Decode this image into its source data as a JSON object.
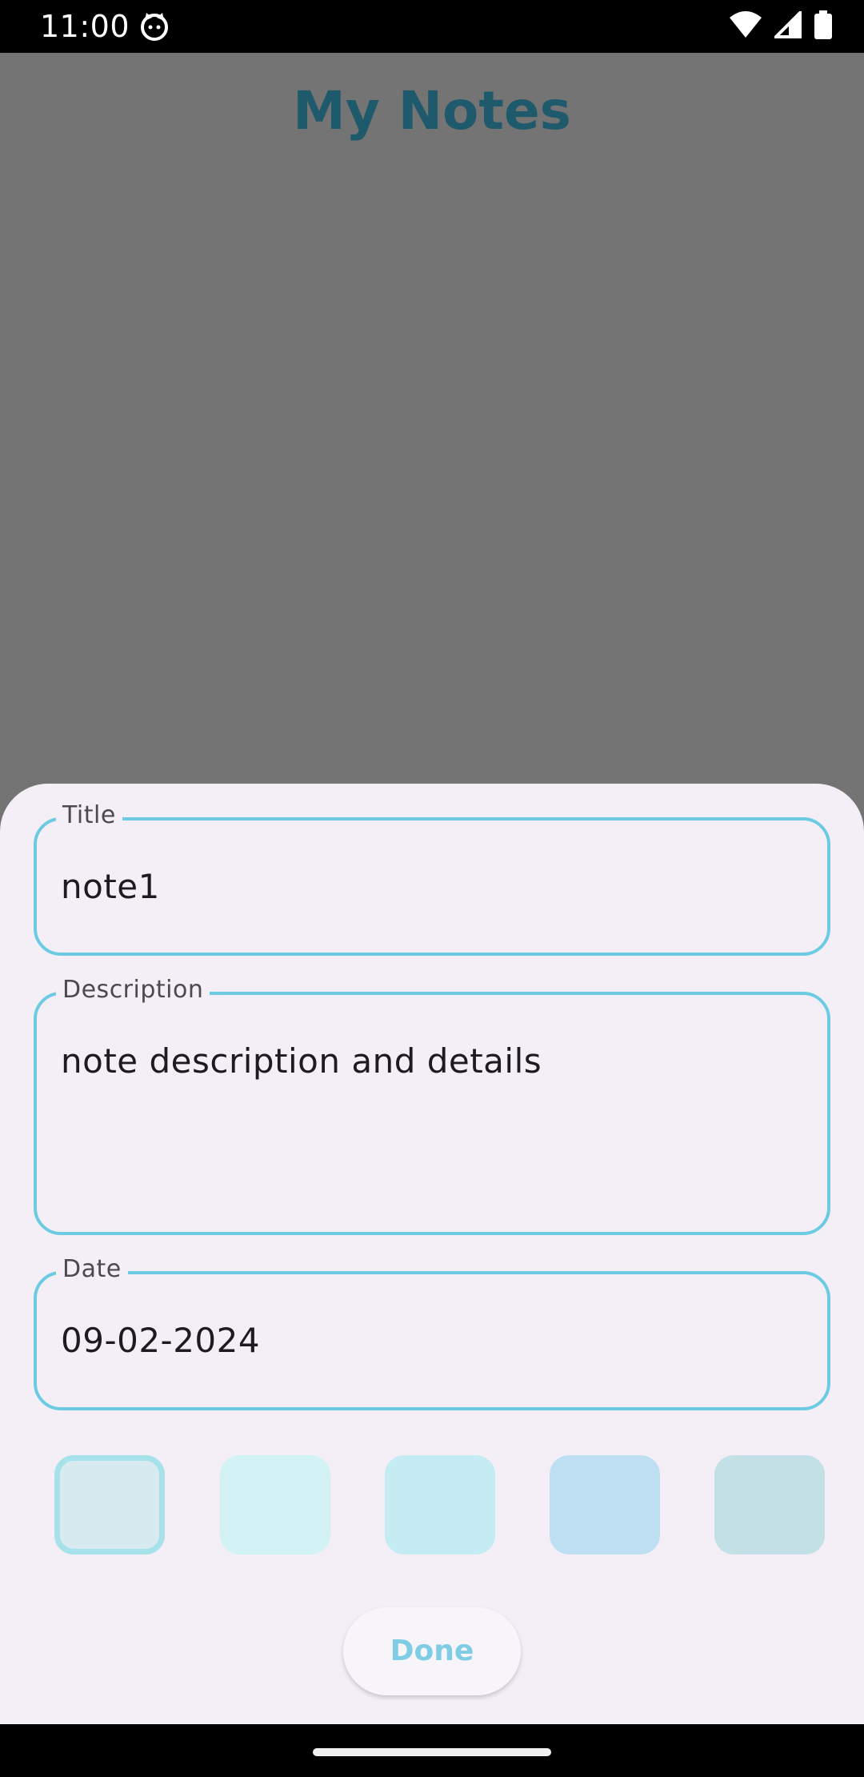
{
  "status_bar": {
    "time": "11:00",
    "app_icon": "cat-face-icon",
    "icons": [
      "wifi-icon",
      "cellular-signal-icon",
      "battery-icon"
    ]
  },
  "header": {
    "title": "My Notes"
  },
  "form": {
    "title_field": {
      "label": "Title",
      "value": "note1"
    },
    "description_field": {
      "label": "Description",
      "value": "note description and details"
    },
    "date_field": {
      "label": "Date",
      "value": "09-02-2024"
    }
  },
  "color_swatches": {
    "colors": [
      "#d6eaf0",
      "#d3f2f5",
      "#c5ebf3",
      "#bfe0f2",
      "#c2e0e5"
    ],
    "selected_index": 0
  },
  "done_button": {
    "label": "Done"
  },
  "theme": {
    "accent": "#6ccbe2",
    "title_color": "#1f5a6c",
    "sheet_background": "#f4eff7",
    "scrim": "#747474"
  }
}
